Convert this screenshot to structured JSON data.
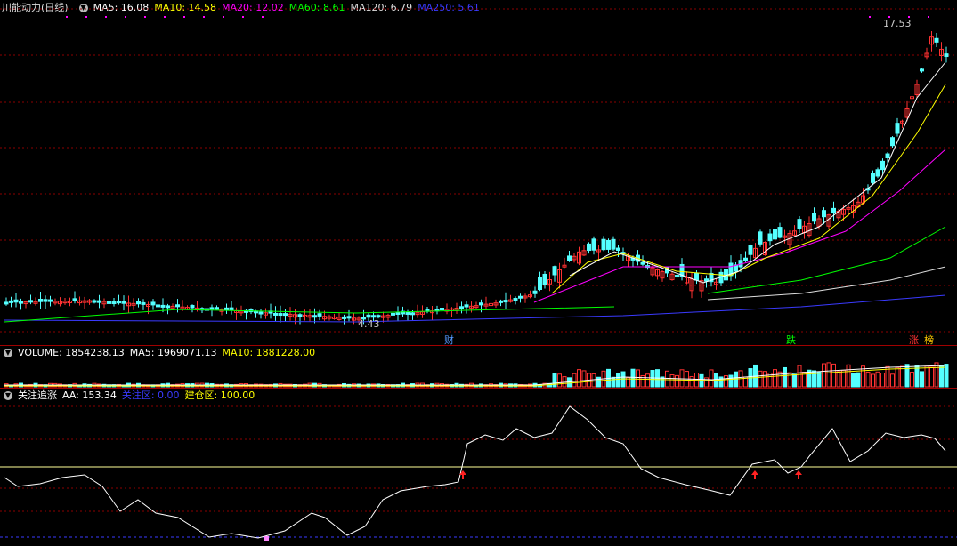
{
  "title": "川能动力(日线)",
  "ma": [
    {
      "label": "MA5: 16.08",
      "color": "#ffffff"
    },
    {
      "label": "MA10: 14.58",
      "color": "#ffff00"
    },
    {
      "label": "MA20: 12.02",
      "color": "#ff00ff"
    },
    {
      "label": "MA60: 8.61",
      "color": "#00ff00"
    },
    {
      "label": "MA120: 6.79",
      "color": "#dddddd"
    },
    {
      "label": "MA250: 5.61",
      "color": "#3030ff"
    }
  ],
  "price_high": "17.53",
  "price_low": "4.43",
  "events": {
    "cai": "财",
    "die": "跌",
    "zhang": "涨",
    "bang": "榜"
  },
  "volume": {
    "label": "VOLUME: 1854238.13",
    "ma5": "MA5: 1969071.13",
    "ma10": "MA10: 1881228.00"
  },
  "indicator": {
    "name": "关注追涨",
    "aa": "AA: 153.34",
    "attention": "关注区: 0.00",
    "build": "建仓区: 100.00"
  },
  "colors": {
    "up": "#ff3232",
    "down": "#54ffff",
    "grid": "#8b0000"
  }
}
